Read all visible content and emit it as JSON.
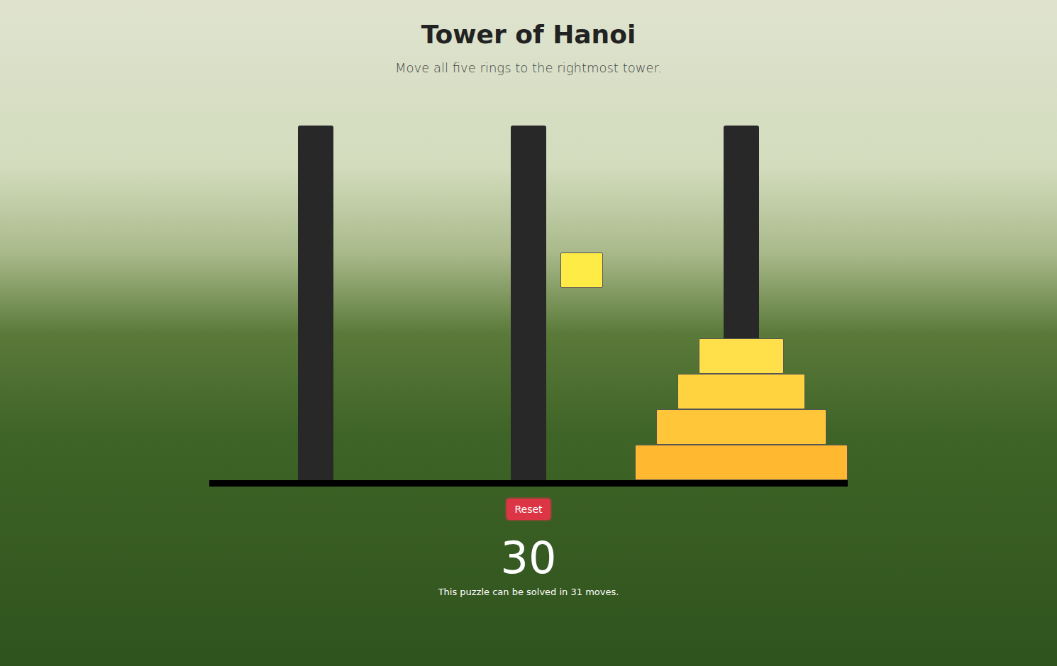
{
  "title": "Tower of Hanoi",
  "subtitle": "Move all five rings to the rightmost tower.",
  "towers": [
    {
      "rings": []
    },
    {
      "rings": []
    },
    {
      "rings": [
        {
          "size": 5,
          "color": "#ffb830"
        },
        {
          "size": 4,
          "color": "#ffc63a"
        },
        {
          "size": 3,
          "color": "#ffd340"
        },
        {
          "size": 2,
          "color": "#ffe04a"
        }
      ]
    }
  ],
  "held_ring": {
    "size": 1,
    "color": "#ffeb45"
  },
  "reset_button": "Reset",
  "moves": "30",
  "caption": "This puzzle can be solved in 31 moves."
}
